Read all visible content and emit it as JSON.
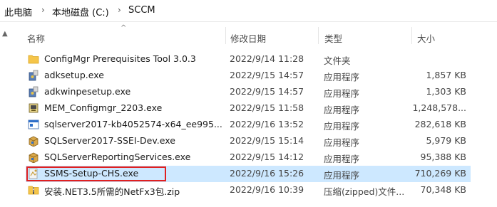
{
  "breadcrumb": {
    "items": [
      "此电脑",
      "本地磁盘 (C:)",
      "SCCM"
    ]
  },
  "columns": {
    "name": "名称",
    "date": "修改日期",
    "type": "类型",
    "size": "大小"
  },
  "files": [
    {
      "name": "ConfigMgr Prerequisites Tool 3.0.3",
      "date": "2022/9/14 11:28",
      "type": "文件夹",
      "size": "",
      "icon": "folder-icon"
    },
    {
      "name": "adksetup.exe",
      "date": "2022/9/15 14:57",
      "type": "应用程序",
      "size": "1,857 KB",
      "icon": "installer-icon"
    },
    {
      "name": "adkwinpesetup.exe",
      "date": "2022/9/15 14:57",
      "type": "应用程序",
      "size": "1,303 KB",
      "icon": "installer-icon"
    },
    {
      "name": "MEM_Configmgr_2203.exe",
      "date": "2022/9/15 11:58",
      "type": "应用程序",
      "size": "1,248,578...",
      "icon": "archive-exe-icon"
    },
    {
      "name": "sqlserver2017-kb4052574-x64_ee995...",
      "date": "2022/9/16 13:52",
      "type": "应用程序",
      "size": "282,618 KB",
      "icon": "window-exe-icon"
    },
    {
      "name": "SQLServer2017-SSEI-Dev.exe",
      "date": "2022/9/15 15:14",
      "type": "应用程序",
      "size": "5,979 KB",
      "icon": "box-installer-icon"
    },
    {
      "name": "SQLServerReportingServices.exe",
      "date": "2022/9/15 14:12",
      "type": "应用程序",
      "size": "95,388 KB",
      "icon": "box-installer-icon"
    },
    {
      "name": "SSMS-Setup-CHS.exe",
      "date": "2022/9/16 15:26",
      "type": "应用程序",
      "size": "710,269 KB",
      "icon": "setup-icon",
      "selected": true
    },
    {
      "name": "安装.NET3.5所需的NetFx3包.zip",
      "date": "2022/9/16 10:39",
      "type": "压缩(zipped)文件...",
      "size": "70,348 KB",
      "icon": "zip-icon"
    }
  ],
  "colors": {
    "selection": "#cde8ff",
    "highlight_box": "#e02020",
    "folder": "#f5c54a"
  }
}
